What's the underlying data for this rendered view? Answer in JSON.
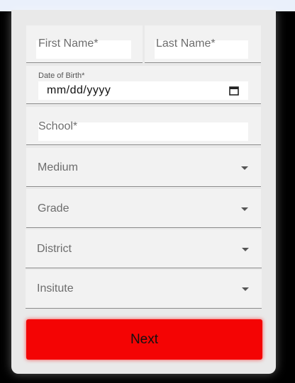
{
  "form": {
    "first_name_placeholder": "First Name*",
    "last_name_placeholder": "Last Name*",
    "dob_label": "Date of Birth*",
    "dob_value": "mm/dd/yyyy",
    "school_placeholder": "School*",
    "medium_label": "Medium",
    "grade_label": "Grade",
    "district_label": "District",
    "institute_label": "Insitute",
    "next_label": "Next"
  },
  "icons": {
    "calendar": "calendar-icon",
    "dropdown": "caret-down-icon"
  },
  "colors": {
    "next_button": "#f40404",
    "field_bg": "#f2f2f2",
    "card_bg": "#e9e9e9"
  }
}
